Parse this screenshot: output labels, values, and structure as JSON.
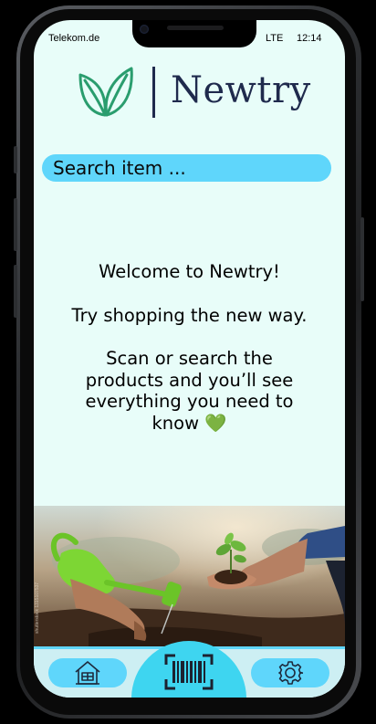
{
  "status_bar": {
    "carrier": "Telekom.de",
    "network": "LTE",
    "time": "12:14"
  },
  "brand": {
    "name": "Newtry",
    "logo_icon": "leaves-icon",
    "leaf_color": "#2a9d6e",
    "text_color": "#1f2a4d"
  },
  "search": {
    "placeholder": "Search item ..."
  },
  "welcome": {
    "line1": "Welcome to Newtry!",
    "line2": "Try shopping the new way.",
    "line3": "Scan or search the products and you’ll see everything you need to know",
    "emoji": "💚"
  },
  "photo": {
    "watermark": "shutterstock 1315107537"
  },
  "nav": {
    "home_icon": "house-icon",
    "scan_icon": "barcode-scan-icon",
    "settings_icon": "gear-icon",
    "accent": "#5fd6fb"
  }
}
